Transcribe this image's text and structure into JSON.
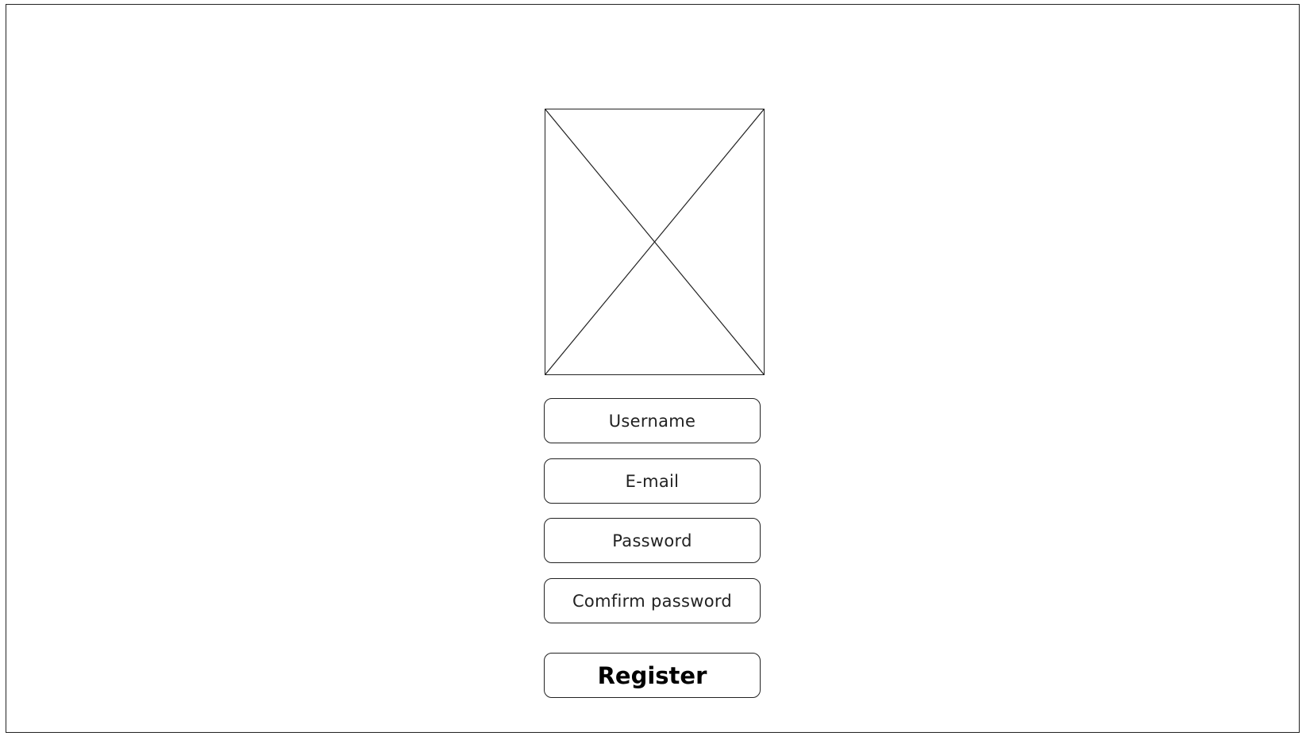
{
  "form": {
    "image_placeholder_icon": "image-placeholder-icon",
    "fields": {
      "username_placeholder": "Username",
      "email_placeholder": "E-mail",
      "password_placeholder": "Password",
      "confirm_password_placeholder": "Comfirm password"
    },
    "register_label": "Register"
  },
  "colors": {
    "stroke": "#222222",
    "background": "#ffffff",
    "text": "#222222"
  }
}
